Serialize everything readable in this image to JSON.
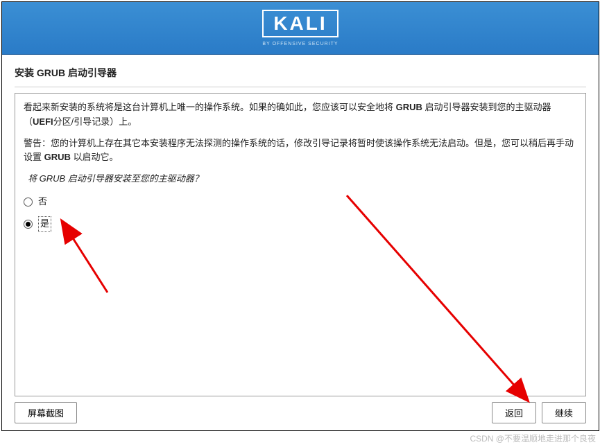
{
  "header": {
    "logo_text": "KALI",
    "logo_subtitle": "BY OFFENSIVE SECURITY"
  },
  "title": "安装 GRUB 启动引导器",
  "content": {
    "desc_part1": "看起来新安装的系统将是这台计算机上唯一的操作系统。如果的确如此，您应该可以安全地将 ",
    "desc_bold1": "GRUB",
    "desc_part2": " 启动引导器安装到您的主驱动器（",
    "desc_bold2": "UEFI",
    "desc_part3": "分区/引导记录）上。",
    "warning_part1": "警告：您的计算机上存在其它本安装程序无法探测的操作系统的话，修改引导记录将暂时使该操作系统无法启动。但是，您可以稍后再手动设置 ",
    "warning_bold": "GRUB",
    "warning_part2": " 以启动它。",
    "question": "将 GRUB 启动引导器安装至您的主驱动器？",
    "options": {
      "no": "否",
      "yes": "是"
    },
    "selected": "yes"
  },
  "buttons": {
    "screenshot": "屏幕截图",
    "back": "返回",
    "continue": "继续"
  },
  "watermark": "CSDN @不要温顺地走进那个良夜"
}
